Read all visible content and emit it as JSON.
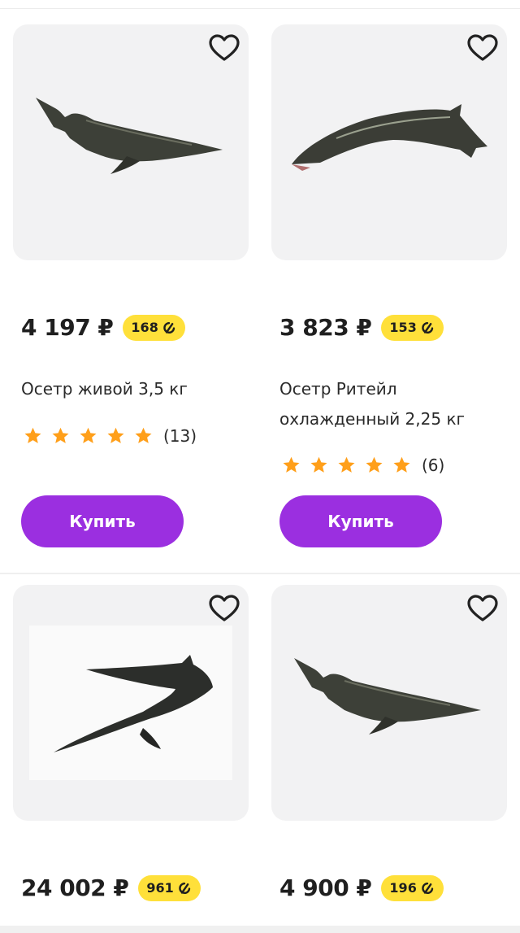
{
  "colors": {
    "accent": "#9b2fe0",
    "bonus_bg": "#ffe03a",
    "star": "#ff9f1a",
    "card_bg": "#f2f2f3"
  },
  "products": [
    {
      "price": "4 197 ₽",
      "bonus": "168",
      "title": "Осетр живой 3,5 кг",
      "rating": 5,
      "reviews": "(13)",
      "buy_label": "Купить",
      "image_icon": "sturgeon-image"
    },
    {
      "price": "3 823 ₽",
      "bonus": "153",
      "title": "Осетр Ритейл охлажденный 2,25 кг",
      "rating": 5,
      "reviews": "(6)",
      "buy_label": "Купить",
      "image_icon": "sturgeon-image"
    },
    {
      "price": "24 002 ₽",
      "bonus": "961",
      "image_icon": "sturgeon-image"
    },
    {
      "price": "4 900 ₽",
      "bonus": "196",
      "image_icon": "sturgeon-image"
    }
  ]
}
